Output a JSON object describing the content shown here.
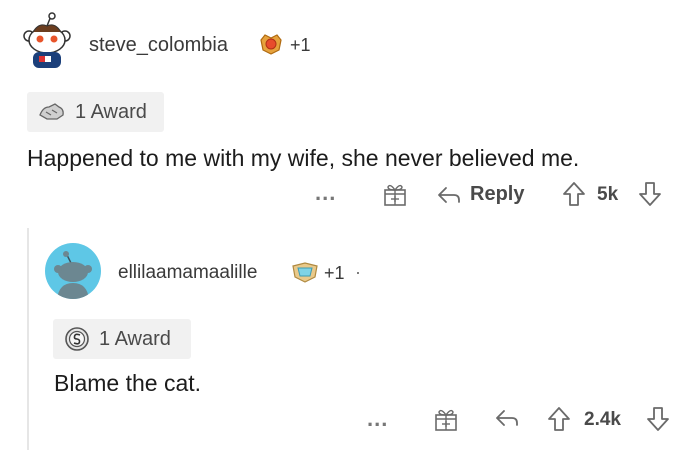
{
  "comment1": {
    "username": "steve_colombia",
    "flair_count": "+1",
    "award_label": "1 Award",
    "body": "Happened to me with my wife, she never believed me.",
    "more_label": "...",
    "reply_label": "Reply",
    "vote_count": "5k"
  },
  "comment2": {
    "username": "ellilaamamaalille",
    "flair_count": "+1",
    "separator": "·",
    "award_label": "1 Award",
    "body": "Blame the cat.",
    "more_label": "...",
    "vote_count": "2.4k"
  },
  "colors": {
    "text": "#1c1c1c",
    "muted": "#6a6a6a",
    "chip_bg": "#f1f1f1",
    "avatar2_bg": "#5ec7e6",
    "thread_line": "#e6e6e6"
  }
}
